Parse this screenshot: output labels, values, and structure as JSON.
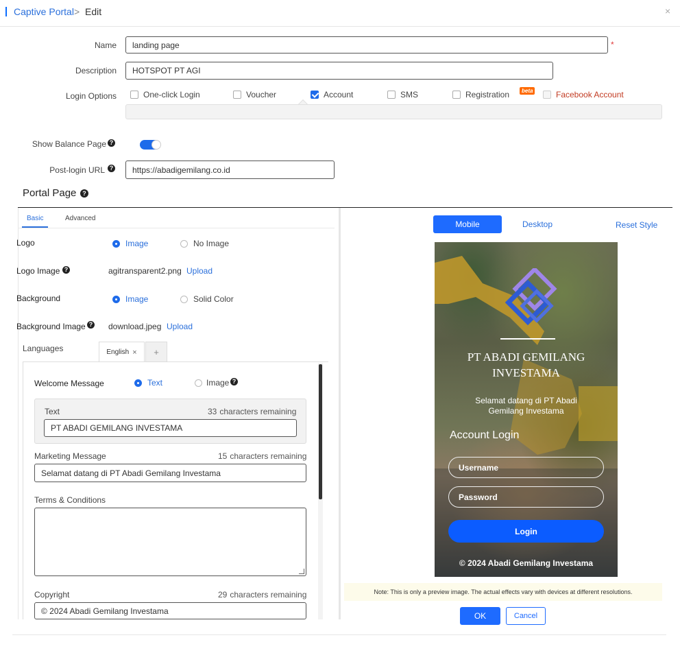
{
  "header": {
    "breadcrumb_root": "Captive Portal",
    "breadcrumb_sep": ">",
    "breadcrumb_current": "Edit",
    "close": "×"
  },
  "form": {
    "name_label": "Name",
    "name_value": "landing page",
    "required_mark": "*",
    "description_label": "Description",
    "description_value": "HOTSPOT PT AGI",
    "login_options_label": "Login Options",
    "login_options": [
      {
        "label": "One-click Login",
        "checked": false
      },
      {
        "label": "Voucher",
        "checked": false
      },
      {
        "label": "Account",
        "checked": true
      },
      {
        "label": "SMS",
        "checked": false
      },
      {
        "label": "Registration",
        "checked": false
      },
      {
        "label": "Facebook Account",
        "checked": false
      }
    ],
    "beta_badge": "beta",
    "show_balance_label": "Show Balance Page",
    "show_balance_on": true,
    "post_login_label": "Post-login URL",
    "post_login_value": "https://abadigemilang.co.id",
    "qmark": "?"
  },
  "portal": {
    "title": "Portal Page",
    "tabs": [
      "Basic",
      "Advanced"
    ],
    "logo_label": "Logo",
    "logo_opt_image": "Image",
    "logo_opt_none": "No Image",
    "logo_image_label": "Logo Image",
    "logo_file": "agitransparent2.png",
    "upload": "Upload",
    "background_label": "Background",
    "bg_opt_image": "Image",
    "bg_opt_solid": "Solid Color",
    "bg_image_label": "Background Image",
    "bg_file": "download.jpeg",
    "languages_label": "Languages",
    "lang_tab": "English",
    "lang_tab_close": "×",
    "lang_add": "+",
    "welcome_label": "Welcome Message",
    "welcome_opt_text": "Text",
    "welcome_opt_image": "Image",
    "text_label": "Text",
    "text_remaining_count": "33",
    "remaining_suffix": "characters remaining",
    "text_value": "PT ABADI GEMILANG INVESTAMA",
    "marketing_label": "Marketing Message",
    "marketing_remaining_count": "15",
    "marketing_value": "Selamat datang di PT Abadi Gemilang Investama",
    "terms_label": "Terms & Conditions",
    "copyright_label": "Copyright",
    "copyright_remaining_count": "29",
    "copyright_value": "© 2024 Abadi Gemilang Investama"
  },
  "preview": {
    "mobile": "Mobile",
    "desktop": "Desktop",
    "reset": "Reset Style",
    "company_line1": "PT ABADI GEMILANG",
    "company_line2": "INVESTAMA",
    "welcome_line1": "Selamat datang di PT Abadi",
    "welcome_line2": "Gemilang Investama",
    "account_login": "Account Login",
    "username": "Username",
    "password": "Password",
    "login": "Login",
    "copyright": "© 2024 Abadi Gemilang Investama",
    "note": "Note: This is only a preview image. The actual effects vary with devices at different resolutions.",
    "ok": "OK",
    "cancel": "Cancel"
  },
  "colors": {
    "accent": "#1e6bff",
    "link": "#2a6fdb",
    "facebook": "#c23b22",
    "beta_badge": "#ff6a00"
  }
}
